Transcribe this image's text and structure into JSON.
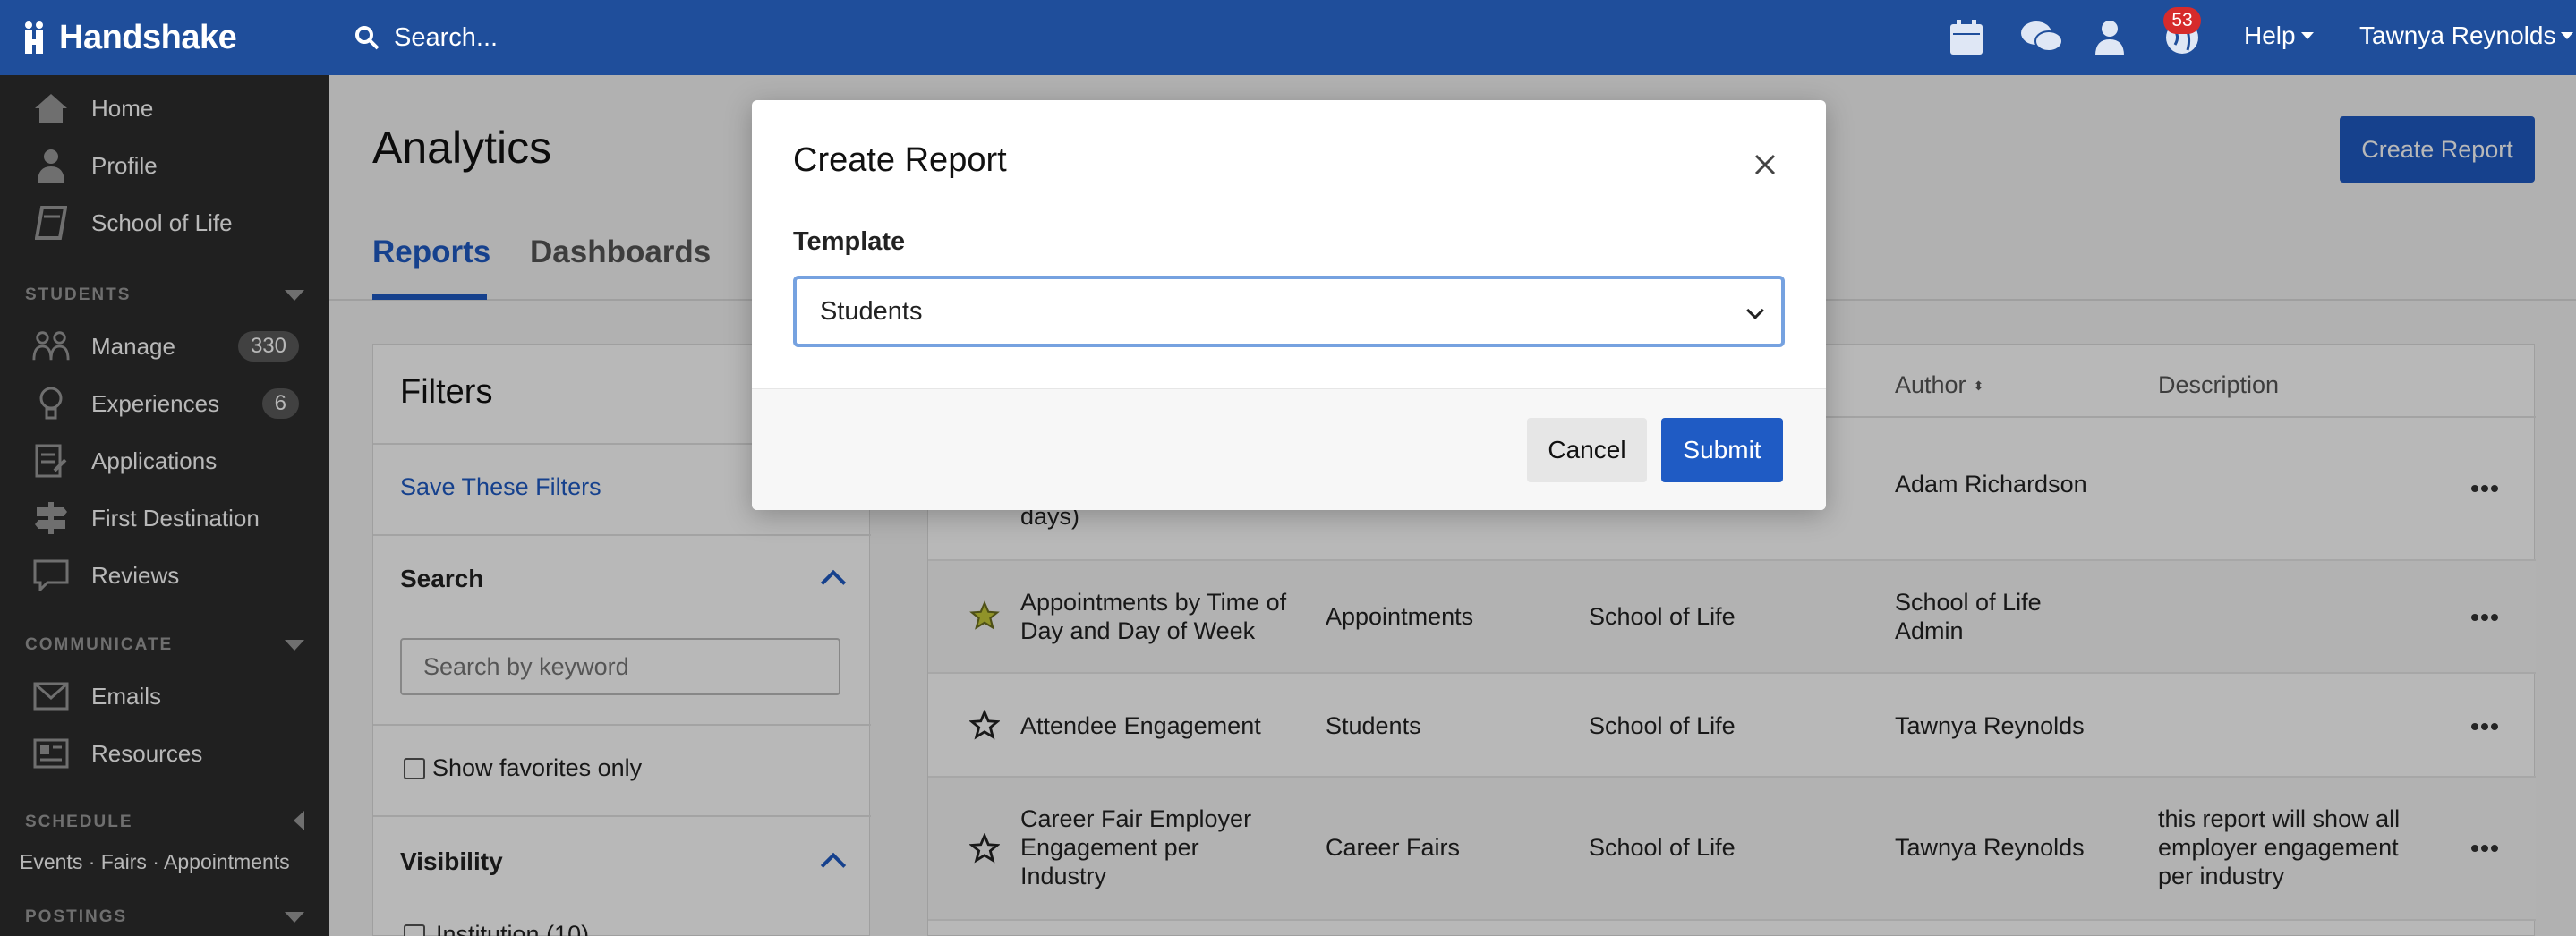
{
  "app": {
    "logo_text": "Handshake",
    "search_placeholder": "Search...",
    "notification_count": "53",
    "help_label": "Help",
    "user_name": "Tawnya Reynolds"
  },
  "sidebar": {
    "top_items": [
      {
        "label": "Home",
        "icon": "home-icon"
      },
      {
        "label": "Profile",
        "icon": "person-icon"
      },
      {
        "label": "School of Life",
        "icon": "book-icon"
      }
    ],
    "students_heading": "STUDENTS",
    "students_items": [
      {
        "label": "Manage",
        "icon": "people-icon",
        "count": "330"
      },
      {
        "label": "Experiences",
        "icon": "lightbulb-icon",
        "count": "6"
      },
      {
        "label": "Applications",
        "icon": "document-icon"
      },
      {
        "label": "First Destination",
        "icon": "signpost-icon"
      },
      {
        "label": "Reviews",
        "icon": "chat-icon"
      }
    ],
    "communicate_heading": "COMMUNICATE",
    "communicate_items": [
      {
        "label": "Emails",
        "icon": "envelope-icon"
      },
      {
        "label": "Resources",
        "icon": "newspaper-icon"
      }
    ],
    "schedule_heading": "SCHEDULE",
    "schedule_links": "Events · Fairs · Appointments",
    "postings_heading": "POSTINGS"
  },
  "page": {
    "title": "Analytics",
    "create_report_label": "Create Report",
    "tabs": [
      "Reports",
      "Dashboards"
    ]
  },
  "filters": {
    "title": "Filters",
    "save_link": "Save These Filters",
    "search_heading": "Search",
    "search_placeholder": "Search by keyword",
    "favorites_label": "Show favorites only",
    "visibility_heading": "Visibility",
    "institution_label": "Institution (10)"
  },
  "table": {
    "headers": {
      "author": "Author",
      "description": "Description"
    },
    "rows": [
      {
        "name": "days)",
        "category": "",
        "visibility": "",
        "author": "Adam Richardson",
        "description": "",
        "favorite": false
      },
      {
        "name": "Appointments by Time of Day and Day of Week",
        "category": "Appointments",
        "visibility": "School of Life",
        "author": "School of Life Admin",
        "description": "",
        "favorite": true
      },
      {
        "name": "Attendee Engagement",
        "category": "Students",
        "visibility": "School of Life",
        "author": "Tawnya Reynolds",
        "description": "",
        "favorite": false
      },
      {
        "name": "Career Fair Employer Engagement per Industry",
        "category": "Career Fairs",
        "visibility": "School of Life",
        "author": "Tawnya Reynolds",
        "description": "this report will show all employer engagement per industry",
        "favorite": false
      }
    ]
  },
  "modal": {
    "title": "Create Report",
    "template_label": "Template",
    "template_value": "Students",
    "cancel_label": "Cancel",
    "submit_label": "Submit"
  },
  "colors": {
    "topbar": "#1f4e9b",
    "primary": "#1f5bc4",
    "sidebar": "#2d2d2d",
    "badge": "#d62b2b",
    "favorite_star": "#c8cc3a"
  }
}
